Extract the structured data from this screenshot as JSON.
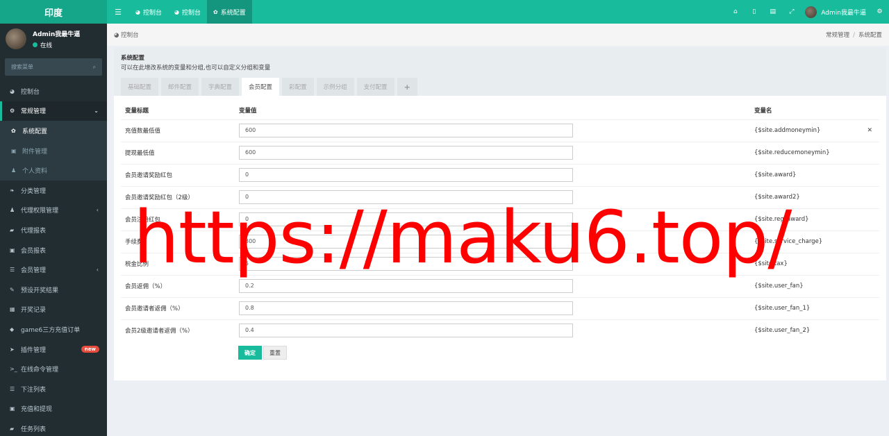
{
  "app": {
    "logo": "印度"
  },
  "topbar": {
    "tabs": [
      {
        "label": "控制台",
        "active": false
      },
      {
        "label": "控制台",
        "active": false
      },
      {
        "label": "系统配置",
        "active": true
      }
    ],
    "user": "Admin我最牛逼"
  },
  "sidebar": {
    "user_name": "Admin我最牛逼",
    "status": "在线",
    "search_placeholder": "搜索菜单",
    "items": [
      {
        "label": "控制台"
      },
      {
        "label": "常规管理"
      },
      {
        "label": "系统配置"
      },
      {
        "label": "附件管理"
      },
      {
        "label": "个人资料"
      },
      {
        "label": "分类管理"
      },
      {
        "label": "代理权限管理"
      },
      {
        "label": "代理报表"
      },
      {
        "label": "会员报表"
      },
      {
        "label": "会员管理"
      },
      {
        "label": "预设开奖结果"
      },
      {
        "label": "开奖记录"
      },
      {
        "label": "game6三方充值订单"
      },
      {
        "label": "插件管理",
        "badge": "new"
      },
      {
        "label": "在线命令管理"
      },
      {
        "label": "下注列表"
      },
      {
        "label": "充值和提现"
      },
      {
        "label": "任务列表"
      }
    ]
  },
  "breadcrumb": {
    "left": "控制台",
    "right": [
      "常规管理",
      "系统配置"
    ]
  },
  "panel": {
    "title": "系统配置",
    "description": "可以在此增改系统的变量和分组,也可以自定义分组和变量",
    "tabs": [
      "基础配置",
      "邮件配置",
      "字典配置",
      "会员配置",
      "彩配置",
      "示例分组",
      "支付配置",
      "+"
    ],
    "active_tab": 3
  },
  "table": {
    "headers": [
      "变量标题",
      "变量值",
      "变量名"
    ],
    "rows": [
      {
        "title": "充值数最低值",
        "value": "600",
        "name": "{$site.addmoneymin}"
      },
      {
        "title": "提现最低值",
        "value": "600",
        "name": "{$site.reducemoneymin}"
      },
      {
        "title": "会员邀请奖励红包",
        "value": "0",
        "name": "{$site.award}"
      },
      {
        "title": "会员邀请奖励红包（2级）",
        "value": "0",
        "name": "{$site.award2}"
      },
      {
        "title": "会员注册红包",
        "value": "0",
        "name": "{$site.reg_award}"
      },
      {
        "title": "手续费",
        "value": "300",
        "name": "{$site.service_charge}"
      },
      {
        "title": "税金比例",
        "value": "5",
        "name": "{$site.tax}"
      },
      {
        "title": "会员返佣（%）",
        "value": "0.2",
        "name": "{$site.user_fan}"
      },
      {
        "title": "会员邀请者返佣（%）",
        "value": "0.8",
        "name": "{$site.user_fan_1}"
      },
      {
        "title": "会员2级邀请者返佣（%）",
        "value": "0.4",
        "name": "{$site.user_fan_2}"
      }
    ]
  },
  "buttons": {
    "submit": "确定",
    "reset": "重置"
  },
  "watermark": "https://maku6.top/"
}
